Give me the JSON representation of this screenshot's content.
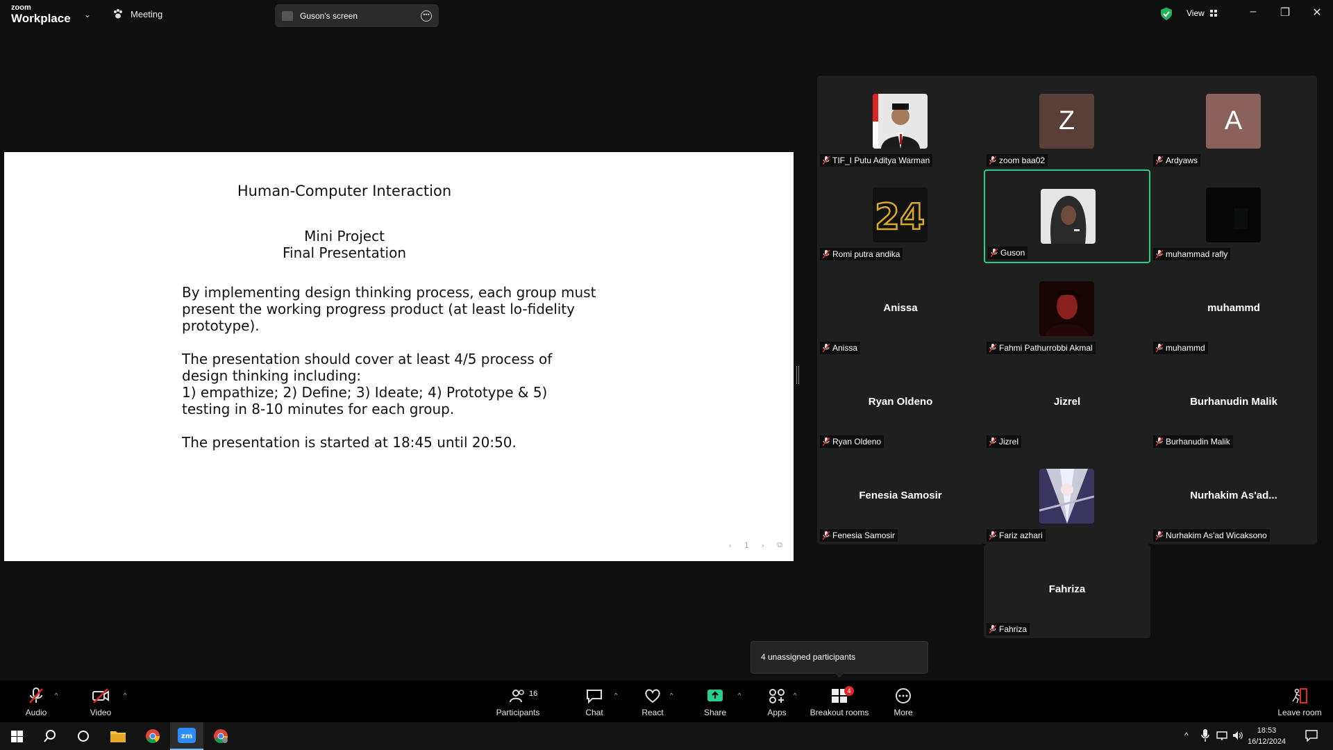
{
  "app": {
    "logo_top": "zoom",
    "logo_bottom": "Workplace",
    "meeting_label": "Meeting",
    "screen_share_label": "Guson's screen",
    "view_label": "View"
  },
  "slide": {
    "title": "Human-Computer Interaction",
    "subtitle_line1": "Mini Project",
    "subtitle_line2": "Final Presentation",
    "para1": "By implementing design thinking process, each group must present the working progress product (at least lo-fidelity prototype).",
    "para2_line1": "The presentation should cover at least 4/5 process of design thinking including:",
    "para2_line2": "1) empathize; 2) Define; 3) Ideate; 4) Prototype & 5) testing in 8-10 minutes for each group.",
    "para3": "The presentation is started at 18:45 until 20:50.",
    "page_number": "1"
  },
  "participants": [
    {
      "name": "TIF_I Putu Aditya Warman",
      "avatar": "photo-formal",
      "initial": ""
    },
    {
      "name": "zoom baa02",
      "avatar": "initial",
      "initial": "Z",
      "color": "#5a3f38"
    },
    {
      "name": "Ardyaws",
      "avatar": "initial",
      "initial": "A",
      "color": "#8a6259"
    },
    {
      "name": "Romi putra andika",
      "avatar": "photo-24",
      "initial": ""
    },
    {
      "name": "Guson",
      "avatar": "photo-hood",
      "initial": "",
      "active": true
    },
    {
      "name": "muhammad rafly",
      "avatar": "photo-dark",
      "initial": ""
    },
    {
      "name": "Anissa",
      "avatar": "none",
      "display_name": "Anissa"
    },
    {
      "name": "Fahmi Pathurrobbi Akmal",
      "avatar": "photo-red",
      "initial": ""
    },
    {
      "name": "muhammd",
      "avatar": "none",
      "display_name": "muhammd"
    },
    {
      "name": "Ryan Oldeno",
      "avatar": "none",
      "display_name": "Ryan Oldeno"
    },
    {
      "name": "Jizrel",
      "avatar": "none",
      "display_name": "Jizrel"
    },
    {
      "name": "Burhanudin Malik",
      "avatar": "none",
      "display_name": "Burhanudin Malik"
    },
    {
      "name": "Fenesia Samosir",
      "avatar": "none",
      "display_name": "Fenesia Samosir"
    },
    {
      "name": "Fariz azhari",
      "avatar": "photo-anime",
      "initial": ""
    },
    {
      "name": "Nurhakim As'ad Wicaksono",
      "avatar": "none",
      "display_name": "Nurhakim  As'ad..."
    },
    {
      "name": "Fahriza",
      "avatar": "none",
      "display_name": "Fahriza"
    }
  ],
  "tooltip": "4 unassigned participants",
  "toolbar": {
    "audio": "Audio",
    "video": "Video",
    "participants": "Participants",
    "participants_count": "16",
    "chat": "Chat",
    "react": "React",
    "share": "Share",
    "apps": "Apps",
    "breakout": "Breakout rooms",
    "breakout_badge": "4",
    "more": "More",
    "leave": "Leave room"
  },
  "taskbar": {
    "time": "18:53",
    "date": "16/12/2024"
  },
  "colors": {
    "active_border": "#23d18b",
    "share_green": "#23d18b",
    "mute_red": "#e02828"
  }
}
